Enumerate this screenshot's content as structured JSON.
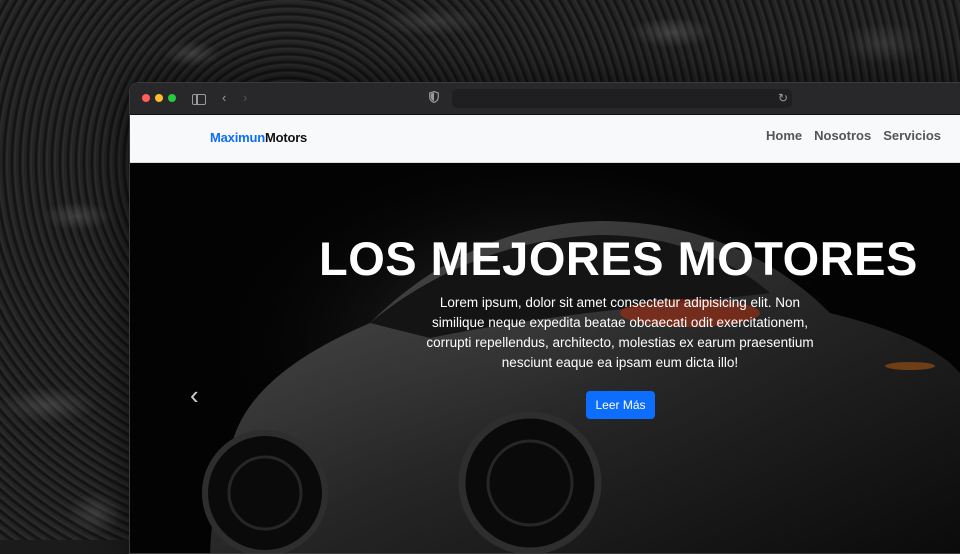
{
  "brand": {
    "part1": "Maximun",
    "part2": "Motors"
  },
  "nav": {
    "home": "Home",
    "about": "Nosotros",
    "services": "Servicios"
  },
  "hero": {
    "title": "LOS MEJORES MOTORES",
    "text": "Lorem ipsum, dolor sit amet consectetur adipisicing elit. Non similique neque expedita beatae obcaecati odit exercitationem, corrupti repellendus, architecto, molestias ex earum praesentium nesciunt eaque ea ipsam eum dicta illo!",
    "button": "Leer Más",
    "prev_glyph": "‹"
  },
  "browser": {
    "back_glyph": "‹",
    "forward_glyph": "›",
    "reload_glyph": "↻"
  },
  "colors": {
    "accent": "#0d6efd",
    "navbar_bg": "#f8f9fa"
  }
}
